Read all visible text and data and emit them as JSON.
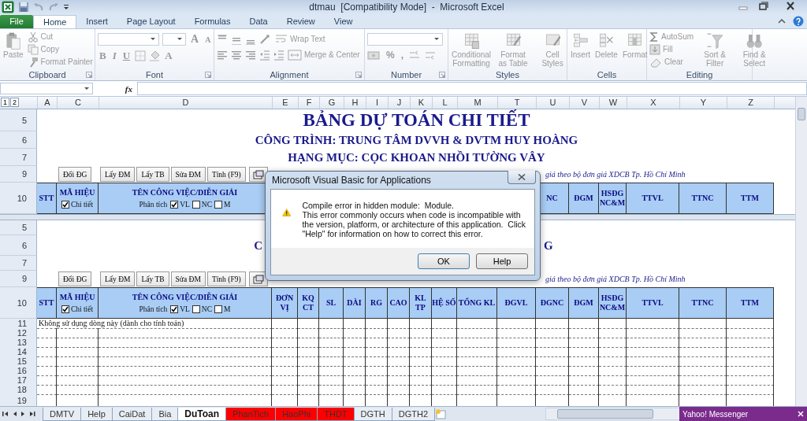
{
  "window": {
    "title": "dtmau  [Compatibility Mode]  -  Microsoft Excel"
  },
  "ribbon_tabs": [
    {
      "label": "File",
      "kind": "file",
      "selected": false
    },
    {
      "label": "Home",
      "kind": "tab",
      "selected": true
    },
    {
      "label": "Insert",
      "kind": "tab",
      "selected": false
    },
    {
      "label": "Page Layout",
      "kind": "tab",
      "selected": false
    },
    {
      "label": "Formulas",
      "kind": "tab",
      "selected": false
    },
    {
      "label": "Data",
      "kind": "tab",
      "selected": false
    },
    {
      "label": "Review",
      "kind": "tab",
      "selected": false
    },
    {
      "label": "View",
      "kind": "tab",
      "selected": false
    }
  ],
  "ribbon": {
    "commands_disabled": true,
    "groups": [
      {
        "label": "Clipboard",
        "items": [
          {
            "kind": "large",
            "label": "Paste"
          },
          {
            "kind": "small",
            "label": "Cut"
          },
          {
            "kind": "small",
            "label": "Copy"
          },
          {
            "kind": "small",
            "label": "Format Painter"
          }
        ]
      },
      {
        "label": "Font",
        "items": [
          {
            "kind": "combo"
          },
          {
            "kind": "combo"
          },
          {
            "kind": "glyph",
            "label": "A"
          },
          {
            "kind": "glyph",
            "label": "A"
          },
          {
            "kind": "glyph",
            "label": "B"
          },
          {
            "kind": "glyph",
            "label": "I"
          },
          {
            "kind": "glyph",
            "label": "U"
          },
          {
            "kind": "tool"
          },
          {
            "kind": "tool"
          },
          {
            "kind": "glyph",
            "label": "A"
          }
        ]
      },
      {
        "label": "Alignment",
        "items": [
          {
            "kind": "tool"
          },
          {
            "kind": "tool"
          },
          {
            "kind": "tool"
          },
          {
            "kind": "tool"
          },
          {
            "kind": "small",
            "label": "Wrap Text"
          },
          {
            "kind": "tool"
          },
          {
            "kind": "tool"
          },
          {
            "kind": "tool"
          },
          {
            "kind": "tool"
          },
          {
            "kind": "tool"
          },
          {
            "kind": "small",
            "label": "Merge & Center"
          }
        ]
      },
      {
        "label": "Number",
        "items": [
          {
            "kind": "combo"
          },
          {
            "kind": "tool"
          },
          {
            "kind": "glyph",
            "label": "%"
          },
          {
            "kind": "glyph",
            "label": ","
          },
          {
            "kind": "tool"
          },
          {
            "kind": "tool"
          }
        ]
      },
      {
        "label": "Styles",
        "items": [
          {
            "kind": "large",
            "label": "Conditional Formatting"
          },
          {
            "kind": "large",
            "label": "Format as Table"
          },
          {
            "kind": "large",
            "label": "Cell Styles"
          }
        ]
      },
      {
        "label": "Cells",
        "items": [
          {
            "kind": "large",
            "label": "Insert"
          },
          {
            "kind": "large",
            "label": "Delete"
          },
          {
            "kind": "large",
            "label": "Format"
          }
        ]
      },
      {
        "label": "Editing",
        "items": [
          {
            "kind": "small",
            "label": "AutoSum"
          },
          {
            "kind": "small",
            "label": "Fill"
          },
          {
            "kind": "small",
            "label": "Clear"
          },
          {
            "kind": "large",
            "label": "Sort & Filter"
          },
          {
            "kind": "large",
            "label": "Find & Select"
          }
        ]
      }
    ]
  },
  "formula_bar": {
    "function_label": "fx"
  },
  "outline_levels": [
    "1",
    "2"
  ],
  "column_headers": [
    "A",
    "C",
    "D",
    "E",
    "F",
    "G",
    "H",
    "I",
    "J",
    "K",
    "L",
    "M",
    "T",
    "U",
    "V",
    "W",
    "X",
    "Y",
    "Z"
  ],
  "panes": [
    {
      "rows": [
        {
          "kind": "title_main",
          "row": "5",
          "text": "BẢNG DỰ TOÁN CHI TIẾT"
        },
        {
          "kind": "title_sub",
          "row": "6",
          "text": "CÔNG TRÌNH: TRUNG TÂM DVVH & DVTM HUY HOÀNG"
        },
        {
          "kind": "title_sub",
          "row": "7",
          "text": "HẠNG MỤC: CỌC KHOAN NHỒI TƯỜNG VÂY"
        },
        {
          "kind": "toolbar",
          "row": "9",
          "buttons": [
            "Đổi ĐG",
            "Lấy ĐM",
            "Lấy TB",
            "Sửa ĐM",
            "Tính (F9)"
          ],
          "note": "giá theo bộ đơn giá XDCB Tp. Hồ Chí Minh"
        },
        {
          "kind": "header",
          "row": "10",
          "cells": [
            {
              "text": "STT"
            },
            {
              "text": "MÃ HIỆU",
              "checks": [
                {
                  "label": "Chi tiết",
                  "checked": true
                }
              ]
            },
            {
              "text": "TÊN CÔNG VIỆC/DIỄN GIẢI",
              "lead": "Phân tích",
              "checks": [
                {
                  "label": "VL",
                  "checked": true
                },
                {
                  "label": "NC",
                  "checked": false
                },
                {
                  "label": "M",
                  "checked": false
                }
              ]
            },
            {},
            {},
            {},
            {},
            {},
            {},
            {},
            {},
            {},
            {},
            {
              "text": "NC"
            },
            {
              "text": "ĐGM"
            },
            {
              "text": "HSĐG NC&M"
            },
            {
              "text": "TTVL"
            },
            {
              "text": "TTNC"
            },
            {
              "text": "TTM"
            }
          ]
        }
      ]
    },
    {
      "rows": [
        {
          "kind": "blank",
          "row": "5"
        },
        {
          "kind": "fragments",
          "row": "6",
          "left": "C",
          "right": "G"
        },
        {
          "kind": "blank",
          "row": "7"
        },
        {
          "kind": "toolbar",
          "row": "9",
          "buttons": [
            "Đổi ĐG",
            "Lấy ĐM",
            "Lấy TB",
            "Sửa ĐM",
            "Tính (F9)"
          ],
          "note": "giá theo bộ đơn giá XDCB Tp. Hồ Chí Minh"
        },
        {
          "kind": "header",
          "row": "10",
          "cells": [
            {
              "text": "STT"
            },
            {
              "text": "MÃ HIỆU",
              "checks": [
                {
                  "label": "Chi tiết",
                  "checked": true
                }
              ]
            },
            {
              "text": "TÊN CÔNG VIỆC/DIỄN GIẢI",
              "lead": "Phân tích",
              "checks": [
                {
                  "label": "VL",
                  "checked": true
                },
                {
                  "label": "NC",
                  "checked": false
                },
                {
                  "label": "M",
                  "checked": false
                }
              ]
            },
            {
              "text": "ĐƠN VỊ"
            },
            {
              "text": "KQ CT"
            },
            {
              "text": "SL"
            },
            {
              "text": "DÀI"
            },
            {
              "text": "RG"
            },
            {
              "text": "CAO"
            },
            {
              "text": "KL TP"
            },
            {
              "text": "HỆ SỐ"
            },
            {
              "text": "TỔNG KL"
            },
            {
              "text": "ĐGVL"
            },
            {
              "text": "ĐGNC"
            },
            {
              "text": "ĐGM"
            },
            {
              "text": "HSĐG NC&M"
            },
            {
              "text": "TTVL"
            },
            {
              "text": "TTNC"
            },
            {
              "text": "TTM"
            }
          ]
        },
        {
          "kind": "note",
          "row": "11",
          "text": "Không sử dụng dòng này (dành cho tính toán)"
        },
        {
          "kind": "empty",
          "row": "12"
        },
        {
          "kind": "empty",
          "row": "13"
        },
        {
          "kind": "empty",
          "row": "14"
        },
        {
          "kind": "empty",
          "row": "15"
        },
        {
          "kind": "empty",
          "row": "16"
        },
        {
          "kind": "empty",
          "row": "17"
        },
        {
          "kind": "empty",
          "row": "18"
        },
        {
          "kind": "empty",
          "row": "19"
        }
      ]
    }
  ],
  "sheet_tabs": [
    {
      "label": "DMTV",
      "selected": false
    },
    {
      "label": "Help",
      "selected": false
    },
    {
      "label": "CaiDat",
      "selected": false
    },
    {
      "label": "Bia",
      "selected": false
    },
    {
      "label": "DuToan",
      "selected": true
    },
    {
      "label": "PhanTich",
      "selected": false,
      "color": "#ff0000"
    },
    {
      "label": "HaoPhi",
      "selected": false,
      "color": "#ff0000"
    },
    {
      "label": "THDT",
      "selected": false,
      "color": "#ff0000"
    },
    {
      "label": "DGTH",
      "selected": false
    },
    {
      "label": "DGTH2",
      "selected": false
    }
  ],
  "dialog": {
    "title": "Microsoft Visual Basic for Applications",
    "message": [
      "Compile error in hidden module:  Module.",
      "This error commonly occurs when code is incompatible with the version, platform, or architecture of this application.  Click \"Help\" for information on how to correct this error."
    ],
    "buttons": [
      "OK",
      "Help"
    ]
  },
  "messenger": {
    "title": "Yahoo! Messenger"
  }
}
